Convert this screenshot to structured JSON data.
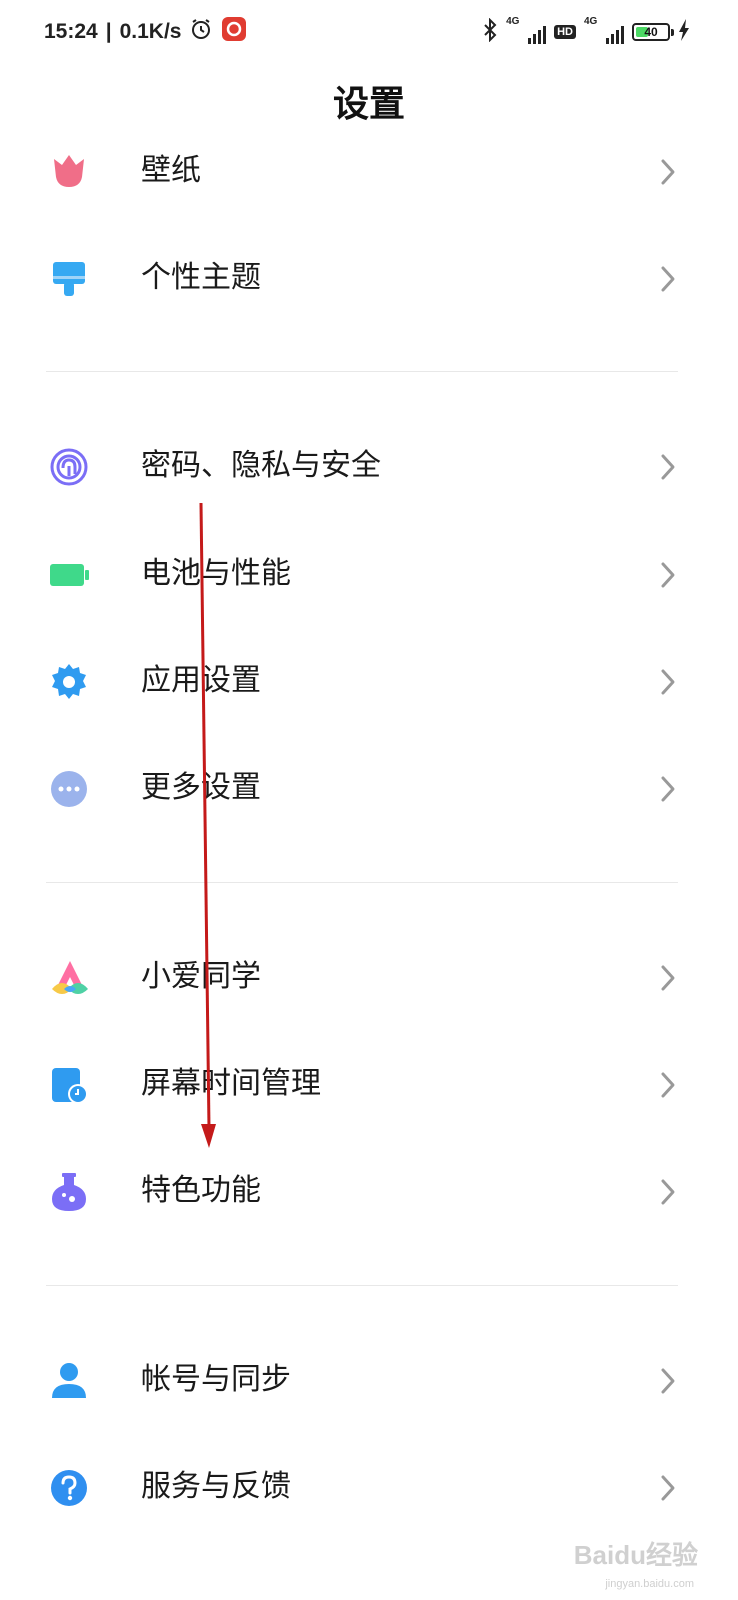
{
  "status_bar": {
    "time": "15:24",
    "separator": "|",
    "speed": "0.1K/s",
    "signal1_label": "4G",
    "hd_label": "HD",
    "signal2_label": "4G",
    "battery_level": "40"
  },
  "header": {
    "title": "设置"
  },
  "sections": [
    {
      "items": [
        {
          "label": "壁纸",
          "icon": "wallpaper-tulip-icon",
          "color": "#f06e88"
        },
        {
          "label": "个性主题",
          "icon": "theme-brush-icon",
          "color": "#36a9f2"
        }
      ]
    },
    {
      "items": [
        {
          "label": "密码、隐私与安全",
          "icon": "fingerprint-icon",
          "color": "#7b6ef6"
        },
        {
          "label": "电池与性能",
          "icon": "battery-icon",
          "color": "#3fd98a"
        },
        {
          "label": "应用设置",
          "icon": "gear-icon",
          "color": "#2f9bf0"
        },
        {
          "label": "更多设置",
          "icon": "more-dots-icon",
          "color": "#9bb3ec"
        }
      ]
    },
    {
      "items": [
        {
          "label": "小爱同学",
          "icon": "xiaoai-icon",
          "color": "#ff6fa3"
        },
        {
          "label": "屏幕时间管理",
          "icon": "screen-time-icon",
          "color": "#2f9bf0"
        },
        {
          "label": "特色功能",
          "icon": "flask-icon",
          "color": "#7b6ef6"
        }
      ]
    },
    {
      "items": [
        {
          "label": "帐号与同步",
          "icon": "account-icon",
          "color": "#2f9bf0"
        },
        {
          "label": "服务与反馈",
          "icon": "help-icon",
          "color": "#2f8ff0"
        }
      ]
    }
  ],
  "watermark": {
    "text": "Baidu经验",
    "sub": "jingyan.baidu.com"
  },
  "annotation": {
    "color": "#c41a1a"
  }
}
